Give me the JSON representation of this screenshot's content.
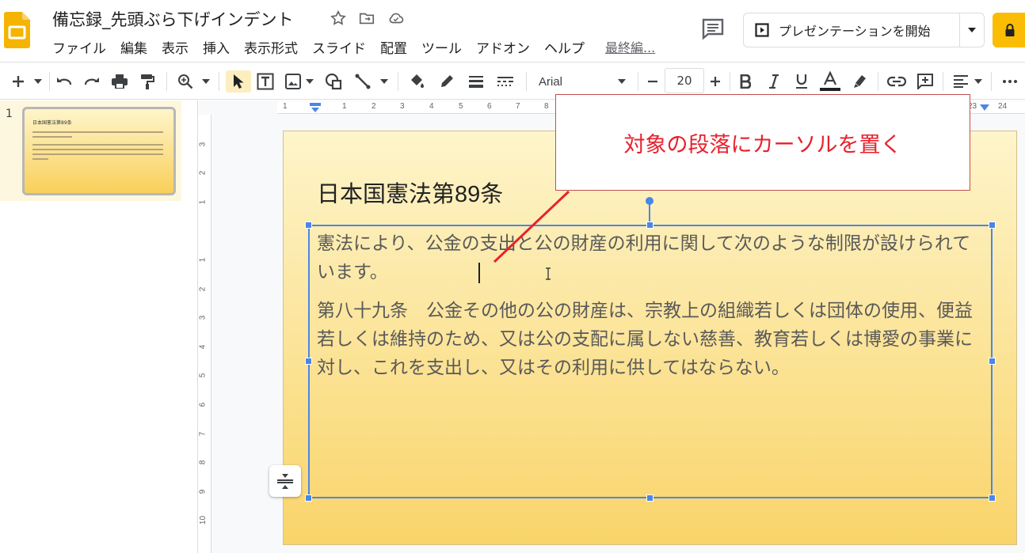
{
  "app": {
    "title": "備忘録_先頭ぶら下げインデント",
    "menu": [
      "ファイル",
      "編集",
      "表示",
      "挿入",
      "表示形式",
      "スライド",
      "配置",
      "ツール",
      "アドオン",
      "ヘルプ"
    ],
    "last_edit": "最終編..."
  },
  "header": {
    "present_label": "プレゼンテーションを開始"
  },
  "toolbar": {
    "font_family": "Arial",
    "font_size": "20"
  },
  "filmstrip": {
    "slide_number": "1"
  },
  "rulers": {
    "horizontal": [
      "1",
      "1",
      "2",
      "3",
      "4",
      "5",
      "6",
      "7",
      "8",
      "23",
      "24"
    ],
    "vertical": [
      "3",
      "2",
      "1",
      "1",
      "2",
      "3",
      "4",
      "5",
      "6",
      "7",
      "8",
      "9",
      "10"
    ]
  },
  "slide": {
    "title": "日本国憲法第89条",
    "para1": "憲法により、公金の支出と公の財産の利用に関して次のような制限が設けられています。",
    "para2": "第八十九条　公金その他の公の財産は、宗教上の組織若しくは団体の使用、便益若しくは維持のため、又は公の支配に属しない慈善、教育若しくは博愛の事業に対し、これを支出し、又はその利用に供してはならない。"
  },
  "callout": {
    "text": "対象の段落にカーソルを置く",
    "color": "#e8212d"
  },
  "colors": {
    "accent_yellow": "#fbbc04",
    "selection_blue": "#4a86e8"
  }
}
